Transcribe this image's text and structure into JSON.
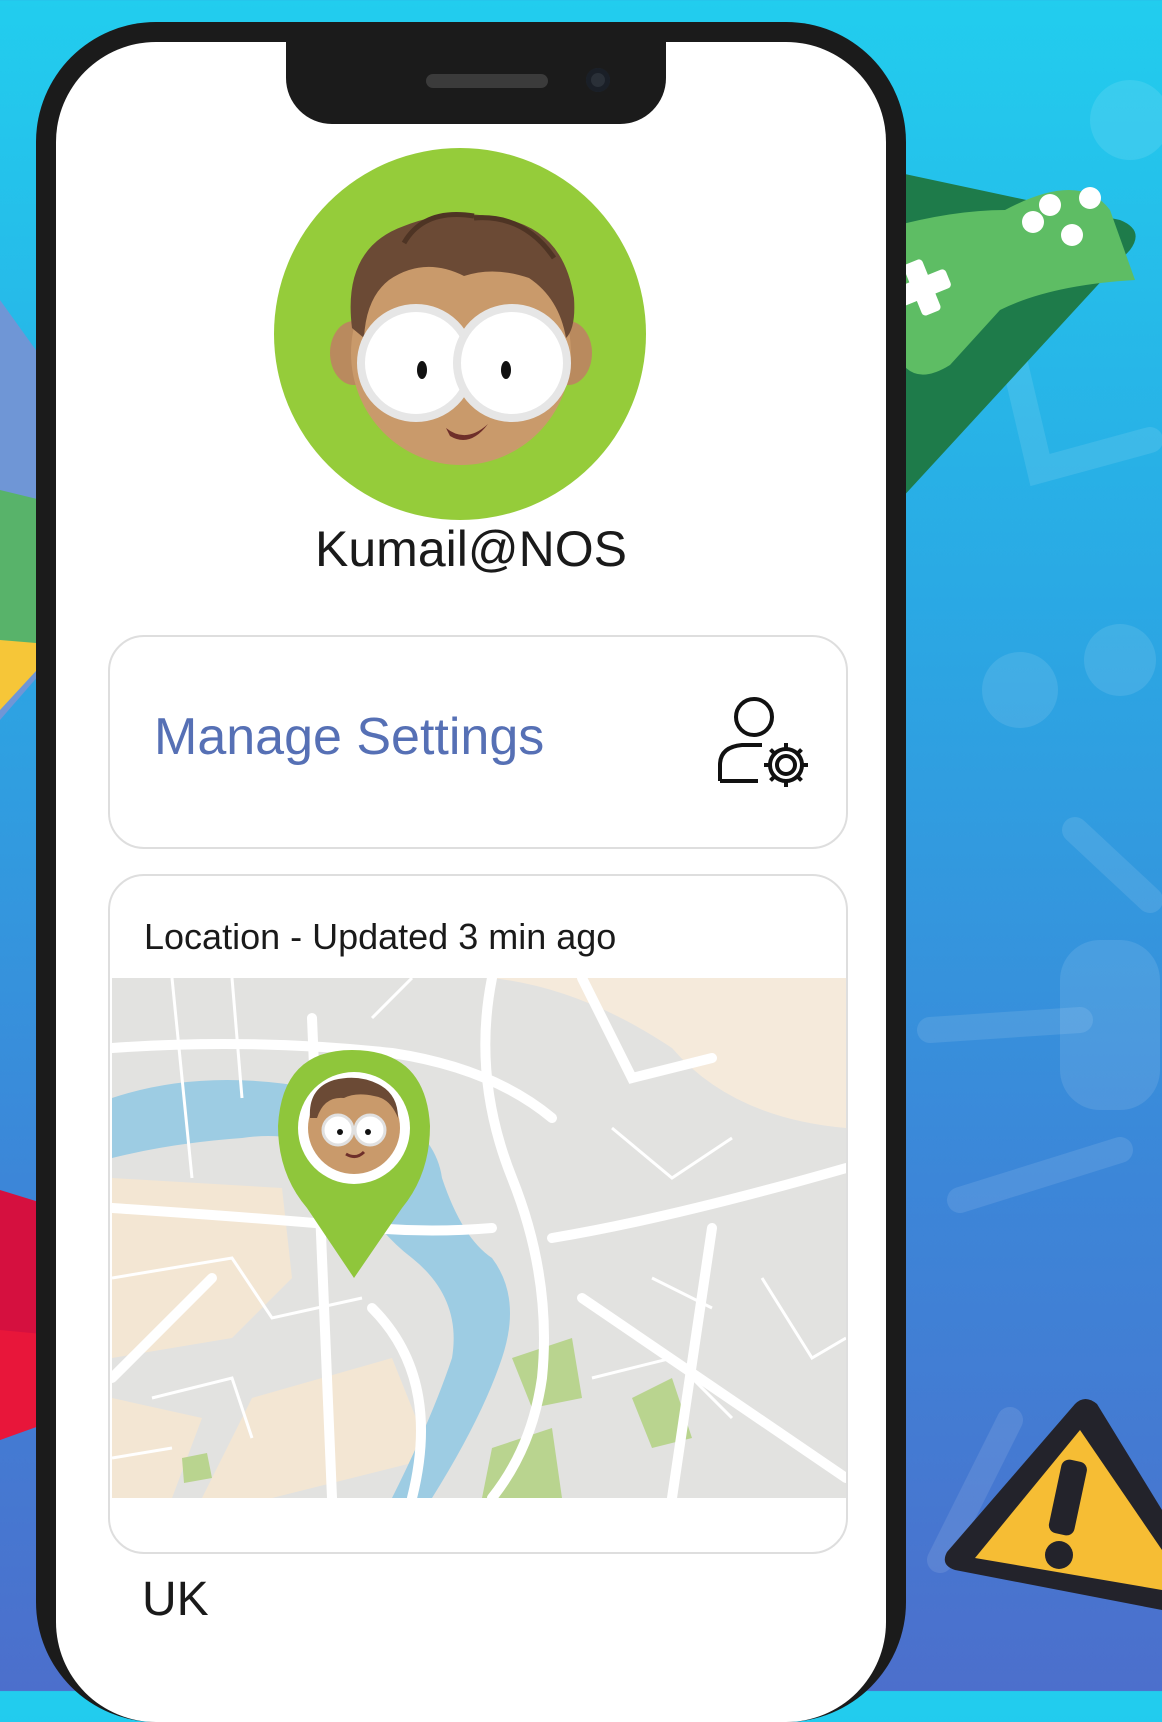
{
  "profile": {
    "username": "Kumail@NOS"
  },
  "settings_card": {
    "label": "Manage Settings",
    "icon": "user-settings-icon"
  },
  "location_card": {
    "title": "Location - Updated 3 min ago",
    "country": "UK"
  },
  "colors": {
    "accent_green": "#95cc3a",
    "link_blue": "#5670b5"
  }
}
